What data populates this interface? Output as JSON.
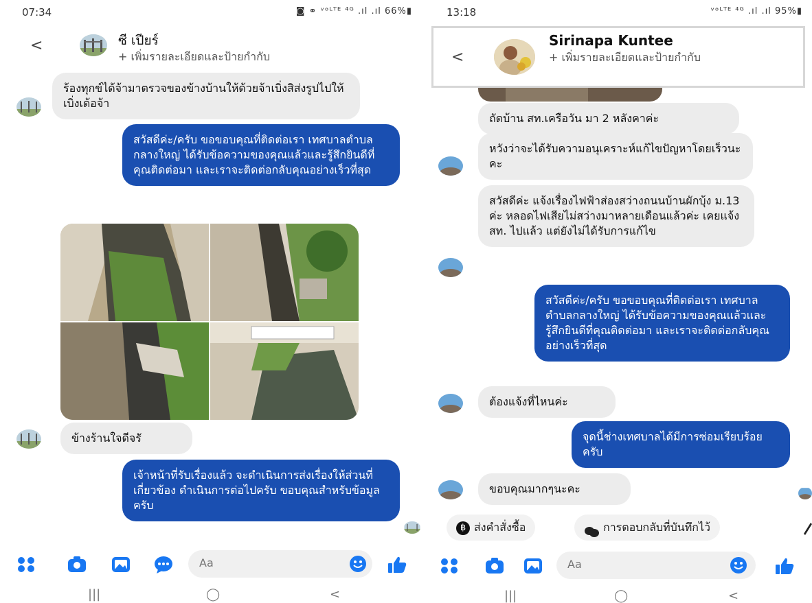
{
  "left": {
    "status": {
      "time": "07:34",
      "icons": "◙ ⚭ ᵛᵒᴸᵀᴱ ⁴ᴳ .ıl .ıl 66%▮"
    },
    "header": {
      "name": "ซี เปียร์",
      "subtitle": "+ เพิ่มรายละเอียดและป้ายกำกับ"
    },
    "messages": [
      {
        "type": "in",
        "text": "ร้องทุกข์ได้จ้ามาตรวจของข้างบ้านให้ด้วยจ้าเบิ่งสิส่งรูปไปให้เบิ่งเด้อจ้า"
      },
      {
        "type": "out",
        "text": "สวัสดีค่ะ/ครับ ขอขอบคุณที่ติดต่อเรา เทศบาลตำบลกลางใหญ่ ได้รับข้อความของคุณแล้วและรู้สึกยินดีที่คุณติดต่อมา และเราจะติดต่อกลับคุณอย่างเร็วที่สุด"
      },
      {
        "type": "in",
        "text": "ข้างร้านใจดีจรั"
      },
      {
        "type": "out",
        "text": "เจ้าหน้าที่รับเรื่องแล้ว จะดำเนินการส่งเรื่องให้ส่วนที่เกี่ยวข้อง ดำเนินการต่อไปครับ ขอบคุณสำหรับข้อมูลครับ"
      }
    ],
    "compose_placeholder": "Aa"
  },
  "right": {
    "status": {
      "time": "13:18",
      "icons": "ᵛᵒᴸᵀᴱ ⁴ᴳ .ıl .ıl 95%▮"
    },
    "header": {
      "name": "Sirinapa Kuntee",
      "subtitle": "+ เพิ่มรายละเอียดและป้ายกำกับ"
    },
    "messages": [
      {
        "type": "in",
        "text": "ถัดบ้าน สท.เครือวัน มา 2 หลังคาค่ะ"
      },
      {
        "type": "in",
        "text": "หวังว่าจะได้รับความอนุเคราะห์แก้ไขปัญหาโดยเร็วนะคะ"
      },
      {
        "type": "in",
        "text": "สวัสดีค่ะ แจ้งเรื่องไฟฟ้าส่องสว่างถนนบ้านผักบุ้ง ม.13 ค่ะ หลอดไฟเสียไม่สว่างมาหลายเดือนแล้วค่ะ เคยแจ้ง สท. ไปแล้ว แต่ยังไม่ได้รับการแก้ไข"
      },
      {
        "type": "out",
        "text": "สวัสดีค่ะ/ครับ ขอขอบคุณที่ติดต่อเรา เทศบาลตำบลกลางใหญ่ ได้รับข้อความของคุณแล้วและรู้สึกยินดีที่คุณติดต่อมา และเราจะติดต่อกลับคุณอย่างเร็วที่สุด"
      },
      {
        "type": "in",
        "text": "ต้องแจ้งที่ไหนค่ะ"
      },
      {
        "type": "out",
        "text": "จุดนี้ช่างเทศบาลได้มีการซ่อมเรียบร้อยครับ"
      },
      {
        "type": "in",
        "text": "ขอบคุณมากๆนะคะ"
      }
    ],
    "quick_replies": [
      "ส่งคำสั่งซื้อ",
      "การตอบกลับที่บันทึกไว้"
    ],
    "compose_placeholder": "Aa"
  },
  "nav": {
    "recent": "|||",
    "home": "◯",
    "back": "<"
  },
  "colors": {
    "accent": "#1a4fb1",
    "icon_blue": "#1877f2"
  }
}
